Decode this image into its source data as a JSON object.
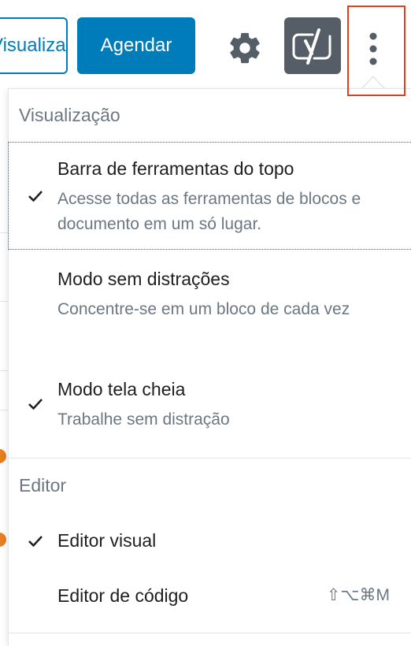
{
  "toolbar": {
    "preview_label": "Visualizar",
    "schedule_label": "Agendar",
    "settings_icon": "gear-icon",
    "yoast_icon": "yoast-icon",
    "more_icon": "more-vertical-icon"
  },
  "colors": {
    "primary": "#007cba",
    "yoast_bg": "#555d66",
    "highlight": "#e2401c",
    "muted_text": "#6c7781"
  },
  "menu": {
    "view_group": {
      "title": "Visualização",
      "items": [
        {
          "label": "Barra de ferramentas do topo",
          "description": "Acesse todas as ferramentas de blocos e documento em um só lugar.",
          "checked": true
        },
        {
          "label": "Modo sem distrações",
          "description": "Concentre-se em um bloco de cada vez",
          "checked": false
        },
        {
          "label": "Modo tela cheia",
          "description": "Trabalhe sem distração",
          "checked": true
        }
      ]
    },
    "editor_group": {
      "title": "Editor",
      "items": [
        {
          "label": "Editor visual",
          "checked": true,
          "shortcut": ""
        },
        {
          "label": "Editor de código",
          "checked": false,
          "shortcut": "⇧⌥⌘M"
        }
      ]
    }
  }
}
